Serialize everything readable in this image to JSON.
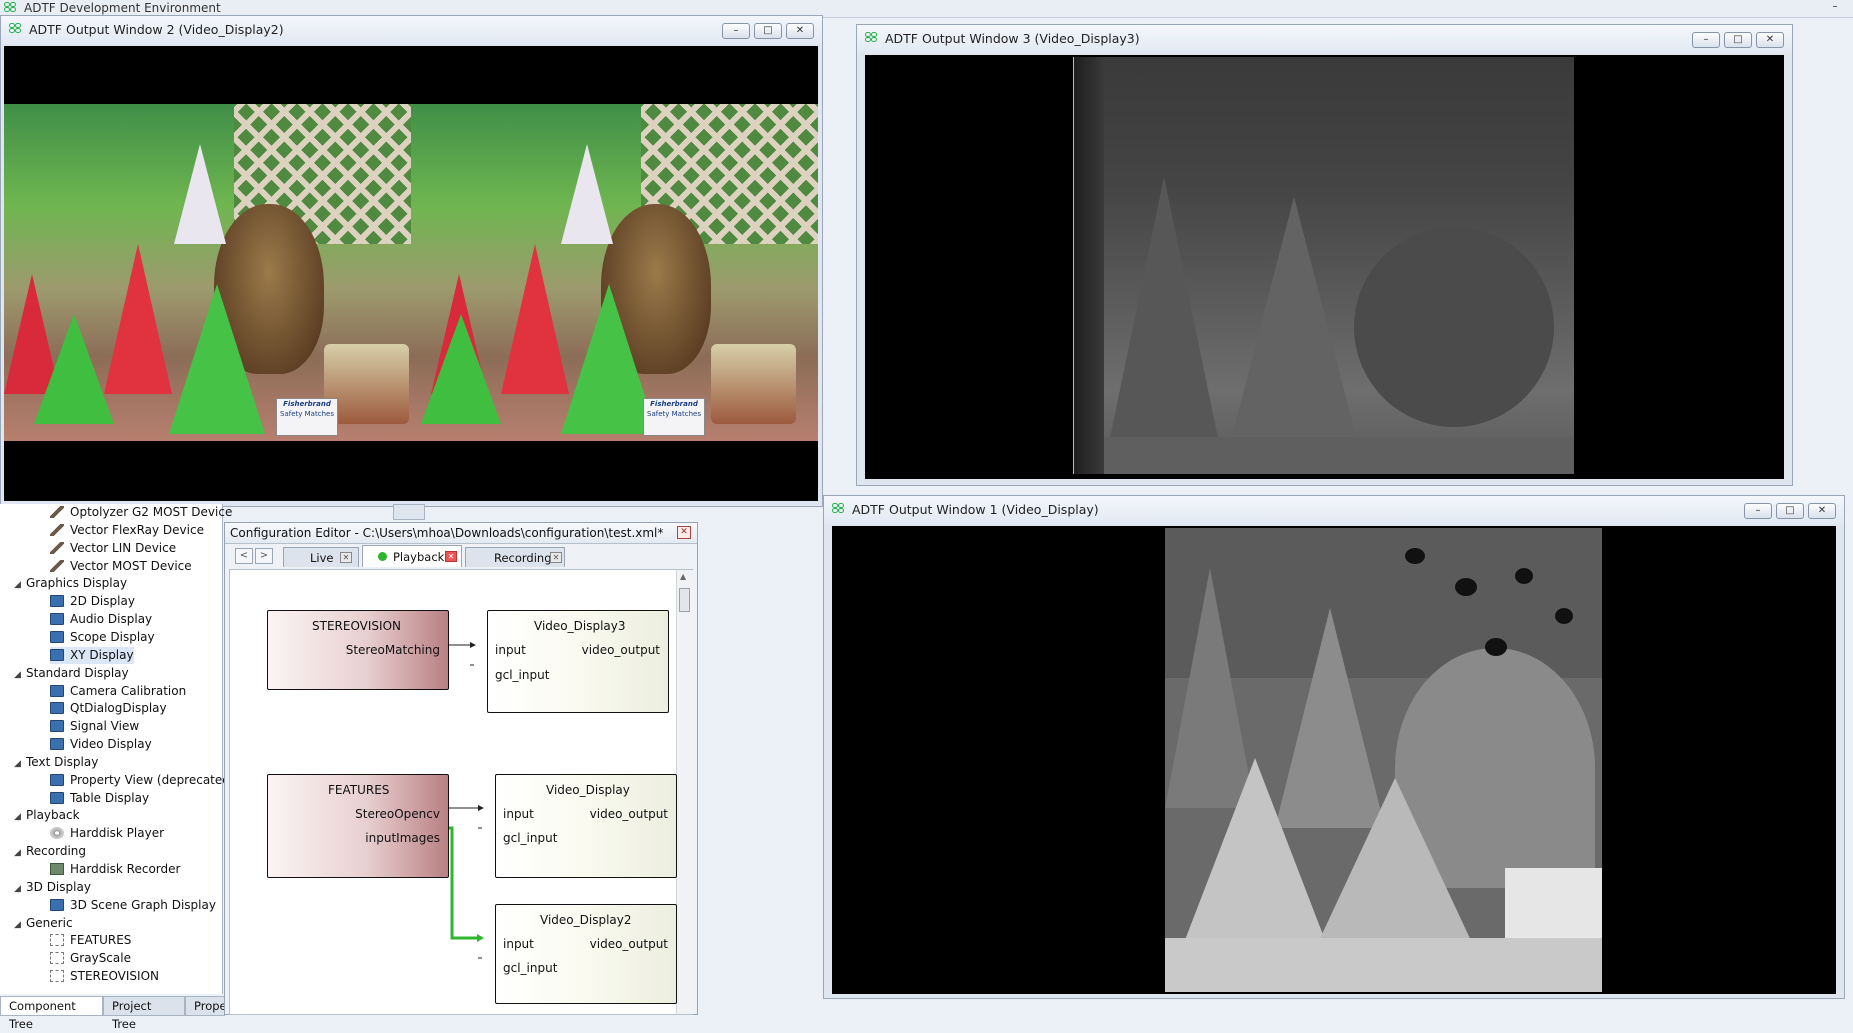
{
  "app": {
    "title": "ADTF Development Environment"
  },
  "win2": {
    "title": "ADTF Output Window 2 (Video_Display2)",
    "min": "–",
    "max": "□",
    "close": "✕"
  },
  "win3": {
    "title": "ADTF Output Window 3 (Video_Display3)",
    "min": "–",
    "max": "□",
    "close": "✕"
  },
  "win1": {
    "title": "ADTF Output Window 1 (Video_Display)",
    "min": "–",
    "max": "□",
    "close": "✕"
  },
  "stereo_image": {
    "label1": "Fisherbrand",
    "label2": "Safety Matches"
  },
  "tree": {
    "items": [
      {
        "label": "Optolyzer G2 MOST Device",
        "icon": "tool-icon"
      },
      {
        "label": "Vector FlexRay Device",
        "icon": "tool-icon"
      },
      {
        "label": "Vector LIN Device",
        "icon": "tool-icon"
      },
      {
        "label": "Vector MOST Device",
        "icon": "tool-icon"
      },
      {
        "label": "Graphics Display",
        "icon": "group"
      },
      {
        "label": "2D Display",
        "icon": "monitor-icon"
      },
      {
        "label": "Audio Display",
        "icon": "monitor-icon"
      },
      {
        "label": "Scope Display",
        "icon": "monitor-icon"
      },
      {
        "label": "XY Display",
        "icon": "monitor-icon"
      },
      {
        "label": "Standard Display",
        "icon": "group"
      },
      {
        "label": "Camera Calibration",
        "icon": "monitor-icon"
      },
      {
        "label": "QtDialogDisplay",
        "icon": "monitor-icon"
      },
      {
        "label": "Signal View",
        "icon": "monitor-icon"
      },
      {
        "label": "Video Display",
        "icon": "monitor-icon"
      },
      {
        "label": "Text Display",
        "icon": "group"
      },
      {
        "label": "Property View (deprecated)",
        "icon": "monitor-icon"
      },
      {
        "label": "Table Display",
        "icon": "monitor-icon"
      },
      {
        "label": "Playback",
        "icon": "group"
      },
      {
        "label": "Harddisk Player",
        "icon": "disc-icon"
      },
      {
        "label": "Recording",
        "icon": "group"
      },
      {
        "label": "Harddisk Recorder",
        "icon": "recorder-icon"
      },
      {
        "label": "3D Display",
        "icon": "group"
      },
      {
        "label": "3D Scene Graph Display",
        "icon": "monitor-icon"
      },
      {
        "label": "Generic",
        "icon": "group"
      },
      {
        "label": "FEATURES",
        "icon": "graph-icon"
      },
      {
        "label": "GrayScale",
        "icon": "graph-icon"
      },
      {
        "label": "STEREOVISION",
        "icon": "graph-icon"
      }
    ],
    "tabs": [
      "Component Tree",
      "Project Tree",
      "Prope"
    ]
  },
  "config_editor": {
    "title": "Configuration Editor - C:\\Users\\mhoa\\Downloads\\configuration\\test.xml*",
    "nav_back": "<",
    "nav_fwd": ">",
    "tabs": [
      "Live",
      "Playback",
      "Recording"
    ],
    "active_tab": "Playback",
    "nodes": {
      "stereovision": {
        "title": "STEREOVISION",
        "out": "StereoMatching"
      },
      "vd3": {
        "title": "Video_Display3",
        "in1": "input",
        "in2": "gcl_input",
        "out": "video_output"
      },
      "features": {
        "title": "FEATURES",
        "out1": "StereoOpencv",
        "out2": "inputImages"
      },
      "vd": {
        "title": "Video_Display",
        "in1": "input",
        "in2": "gcl_input",
        "out": "video_output"
      },
      "vd2": {
        "title": "Video_Display2",
        "in1": "input",
        "in2": "gcl_input",
        "out": "video_output"
      }
    }
  },
  "colors": {
    "accent_green": "#26b14a",
    "selected_link": "#2fb52f"
  }
}
